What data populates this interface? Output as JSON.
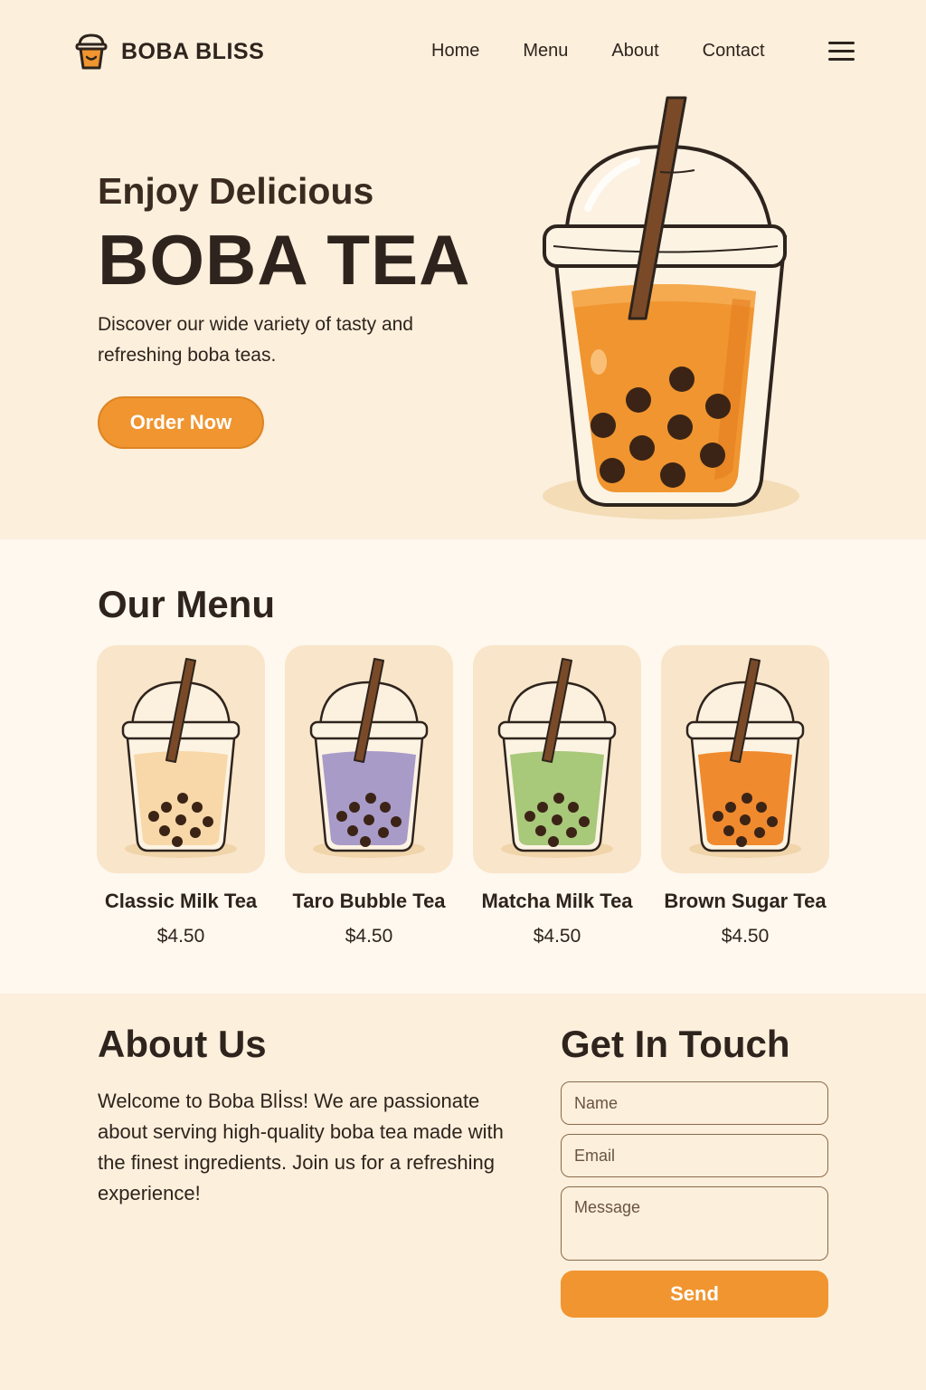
{
  "brand": {
    "name": "BOBA BLISS",
    "accent": "#f0952f",
    "background": "#fcefdc"
  },
  "nav": {
    "items": [
      "Home",
      "Menu",
      "About",
      "Contact"
    ]
  },
  "hero": {
    "subtitle": "Enjoy Delicious",
    "title": "BOBA TEA",
    "description": "Discover our wide variety of tasty and refreshing boba teas.",
    "cta": "Order Now"
  },
  "menu": {
    "title": "Our Menu",
    "items": [
      {
        "name": "Classic Milk Tea",
        "price": "$4.50",
        "color": "#f8d8a8"
      },
      {
        "name": "Taro Bubble Tea",
        "price": "$4.50",
        "color": "#a99bc8"
      },
      {
        "name": "Matcha Milk Tea",
        "price": "$4.50",
        "color": "#a8c87a"
      },
      {
        "name": "Brown Sugar Tea",
        "price": "$4.50",
        "color": "#f08a2e"
      }
    ]
  },
  "about": {
    "title": "About Us",
    "text": "Welcome to Boba Blİss! We are passionate about serving high-quality boba tea made with the finest ingredients. Join us for a refreshing experience!"
  },
  "contact": {
    "title": "Get In Touch",
    "name_placeholder": "Name",
    "email_placeholder": "Email",
    "message_placeholder": "Message",
    "send": "Send"
  }
}
